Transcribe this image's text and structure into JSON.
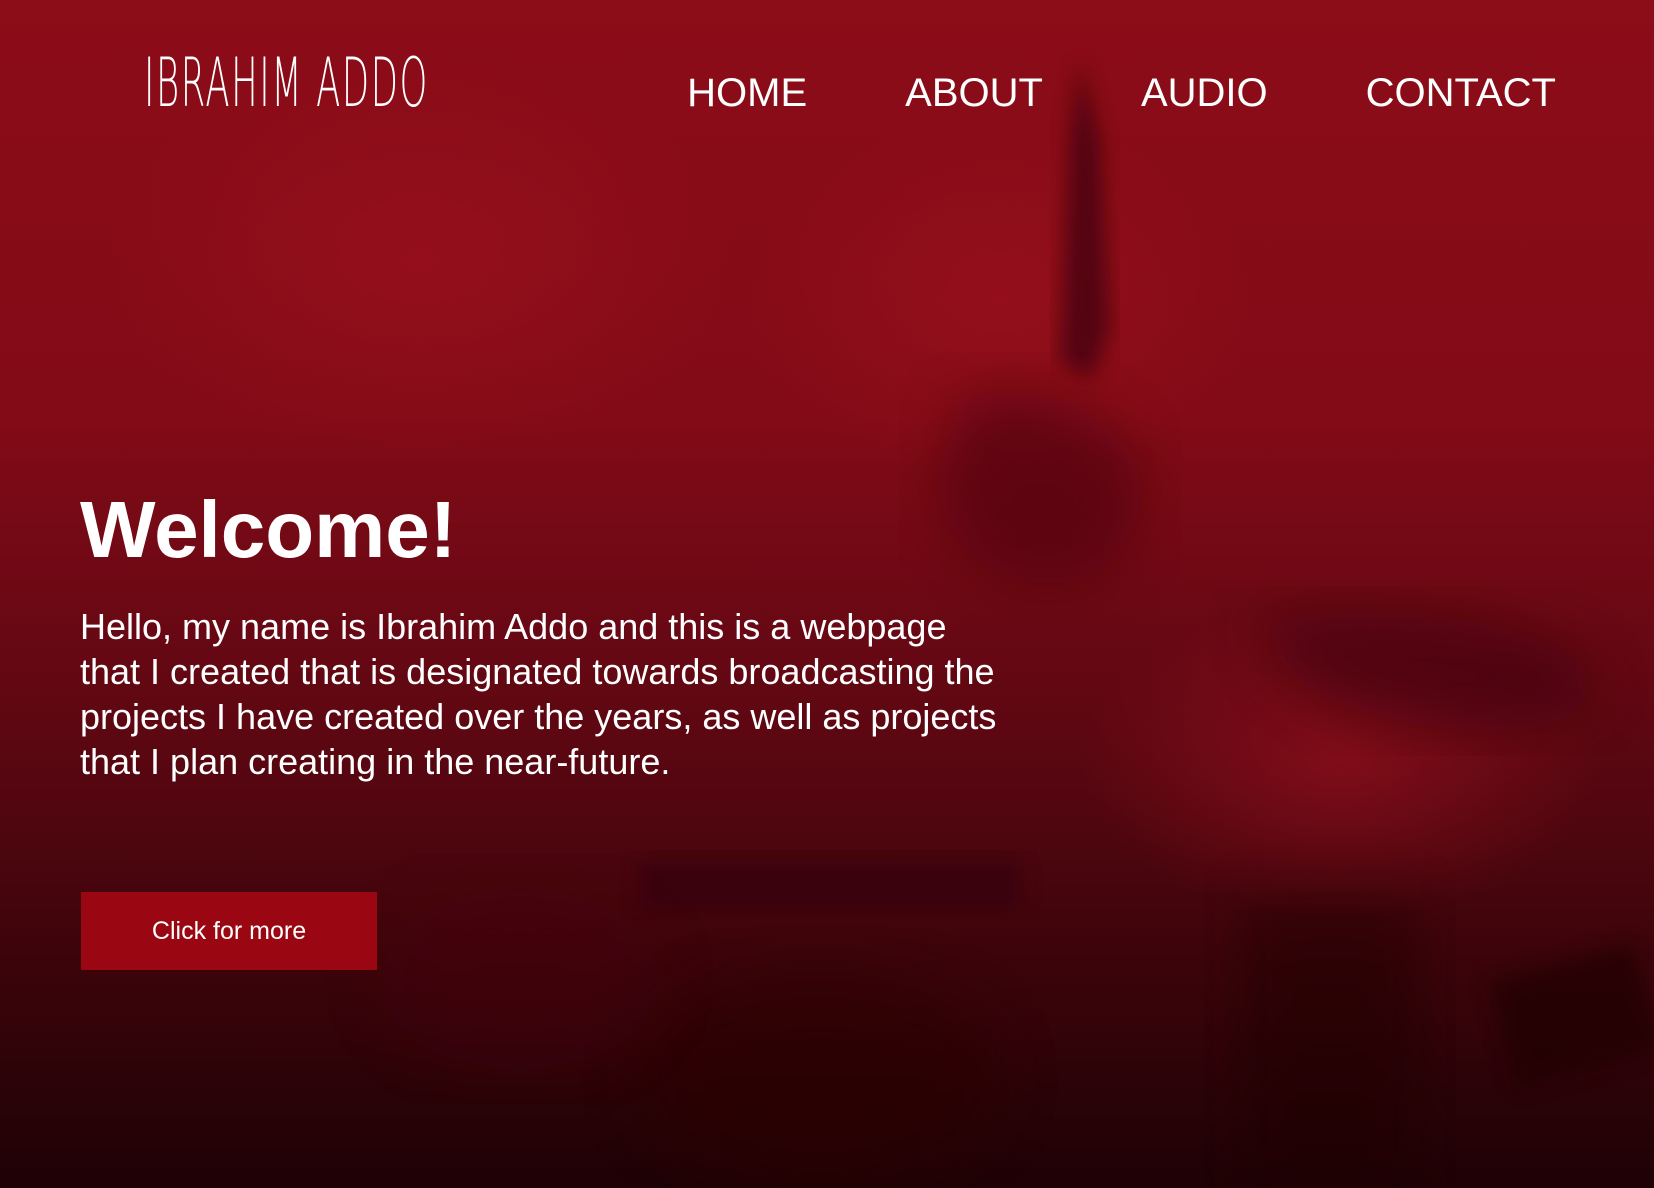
{
  "brand": {
    "name": "IBRAHIM ADDO"
  },
  "nav": {
    "items": [
      {
        "label": "HOME"
      },
      {
        "label": "ABOUT"
      },
      {
        "label": "AUDIO"
      },
      {
        "label": "CONTACT"
      }
    ]
  },
  "hero": {
    "title": "Welcome!",
    "text": "Hello, my name is Ibrahim Addo and this is a webpage that I created that is designated towards broadcasting the projects I have created over the years, as well as projects that I plan creating in the near-future.",
    "button_label": "Click for more"
  },
  "colors": {
    "background_top": "#8c0c18",
    "background_bottom": "#1e0205",
    "button": "#9a0611",
    "text": "#ffffff"
  }
}
